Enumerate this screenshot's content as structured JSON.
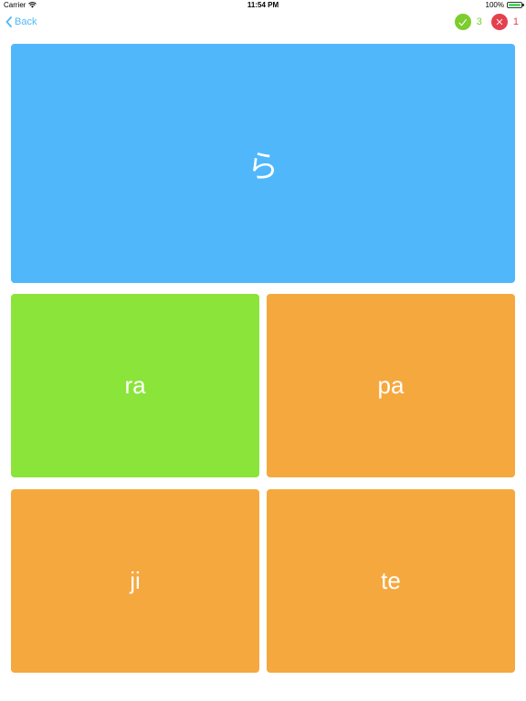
{
  "status_bar": {
    "carrier": "Carrier",
    "time": "11:54 PM",
    "battery": "100%",
    "battery_color": "#4cd964",
    "wifi_icon": "wifi-icon"
  },
  "nav": {
    "back_label": "Back",
    "back_icon": "chevron-left-icon",
    "accent_color": "#4fb8f7"
  },
  "score": {
    "correct_count": "3",
    "wrong_count": "1",
    "correct_icon": "checkmark-icon",
    "wrong_icon": "x-mark-icon",
    "correct_color": "#7ccd2d",
    "wrong_color": "#e5404e"
  },
  "quiz": {
    "prompt": "ら",
    "prompt_color": "#50b7fb",
    "answers": [
      {
        "label": "ra",
        "color": "#8ae43a",
        "state": "correct"
      },
      {
        "label": "pa",
        "color": "#f5a83e",
        "state": "default"
      },
      {
        "label": "ji",
        "color": "#f5a83e",
        "state": "default"
      },
      {
        "label": "te",
        "color": "#f5a83e",
        "state": "default"
      }
    ]
  }
}
